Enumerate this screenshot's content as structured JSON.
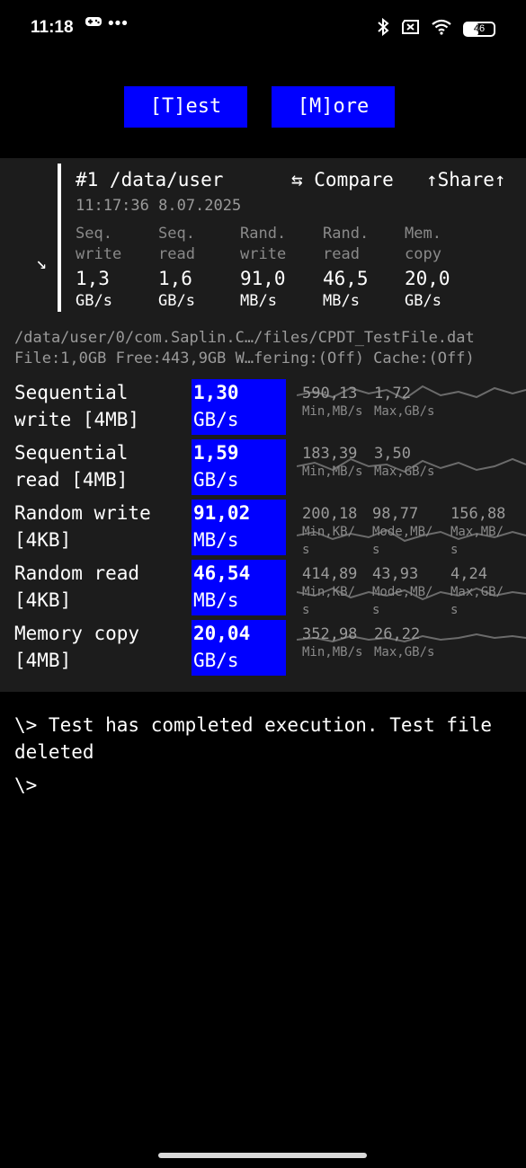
{
  "status_bar": {
    "time": "11:18",
    "dots": "•••",
    "battery_level": "46"
  },
  "actions": {
    "test_label": "[T]est",
    "more_label": "[M]ore"
  },
  "history": {
    "run_title": "#1 /data/user",
    "compare_label": "⇆ Compare",
    "share_label": "↑Share↑",
    "timestamp": "11:17:36 8.07.2025",
    "expand_arrow": "↘",
    "summary": [
      {
        "label1": "Seq.",
        "label2": "write",
        "value": "1,3",
        "unit": "GB/s"
      },
      {
        "label1": "Seq.",
        "label2": "read",
        "value": "1,6",
        "unit": "GB/s"
      },
      {
        "label1": "Rand.",
        "label2": "write",
        "value": "91,0",
        "unit": "MB/s"
      },
      {
        "label1": "Rand.",
        "label2": "read",
        "value": "46,5",
        "unit": "MB/s"
      },
      {
        "label1": "Mem.",
        "label2": "copy",
        "value": "20,0",
        "unit": "GB/s"
      }
    ]
  },
  "file_info": {
    "path": "/data/user/0/com.Saplin.C…/files/CPDT_TestFile.dat",
    "details": "File:1,0GB Free:443,9GB W…fering:(Off) Cache:(Off)"
  },
  "results": [
    {
      "name": "Sequential\nwrite [4MB]",
      "value": "1,30",
      "unit": "GB/s",
      "stats": [
        {
          "v": "590,13",
          "l": "Min,MB/s"
        },
        {
          "v": "1,72",
          "l": "Max,GB/s"
        }
      ]
    },
    {
      "name": "Sequential\nread [4MB]",
      "value": "1,59",
      "unit": "GB/s",
      "stats": [
        {
          "v": "183,39",
          "l": "Min,MB/s"
        },
        {
          "v": "3,50",
          "l": "Max,GB/s"
        }
      ]
    },
    {
      "name": "Random write\n[4KB]",
      "value": "91,02",
      "unit": "MB/s",
      "stats": [
        {
          "v": "200,18",
          "l": "Min,KB/\ns"
        },
        {
          "v": "98,77",
          "l": "Mode,MB/\ns"
        },
        {
          "v": "156,88",
          "l": "Max,MB/\ns"
        }
      ]
    },
    {
      "name": "Random read\n[4KB]",
      "value": "46,54",
      "unit": "MB/s",
      "stats": [
        {
          "v": "414,89",
          "l": "Min,KB/\ns"
        },
        {
          "v": "43,93",
          "l": "Mode,MB/\ns"
        },
        {
          "v": "4,24",
          "l": "Max,GB/\ns"
        }
      ]
    },
    {
      "name": "Memory copy\n[4MB]",
      "value": "20,04",
      "unit": "GB/s",
      "stats": [
        {
          "v": "352,98",
          "l": "Min,MB/s"
        },
        {
          "v": "26,22",
          "l": "Max,GB/s"
        }
      ]
    }
  ],
  "console": {
    "message": "\\> Test has completed execution. Test file deleted",
    "prompt": "\\>"
  },
  "colors": {
    "accent": "#0000ff",
    "background": "#000000",
    "panel": "#1c1c1c",
    "muted_text": "#9a9a9a"
  }
}
